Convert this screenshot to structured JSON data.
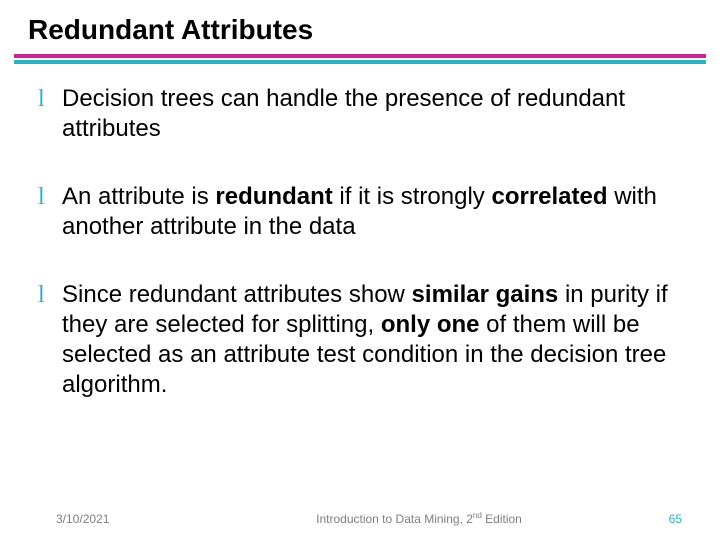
{
  "title": "Redundant Attributes",
  "bullets": [
    {
      "mark": "l",
      "html": "Decision trees can handle the presence of redundant attributes"
    },
    {
      "mark": "l",
      "html": "An attribute is <b>redundant</b> if it is strongly <b>correlated</b> with another attribute in the data"
    },
    {
      "mark": "l",
      "html": "Since redundant attributes show <b>similar gains</b> in purity if they are selected for splitting, <b>only one</b> of them will be selected as an attribute test condition in the decision tree algorithm."
    }
  ],
  "footer": {
    "date": "3/10/2021",
    "center_pre": "Introduction to Data Mining, 2",
    "center_sup": "nd",
    "center_post": " Edition",
    "page": "65"
  }
}
